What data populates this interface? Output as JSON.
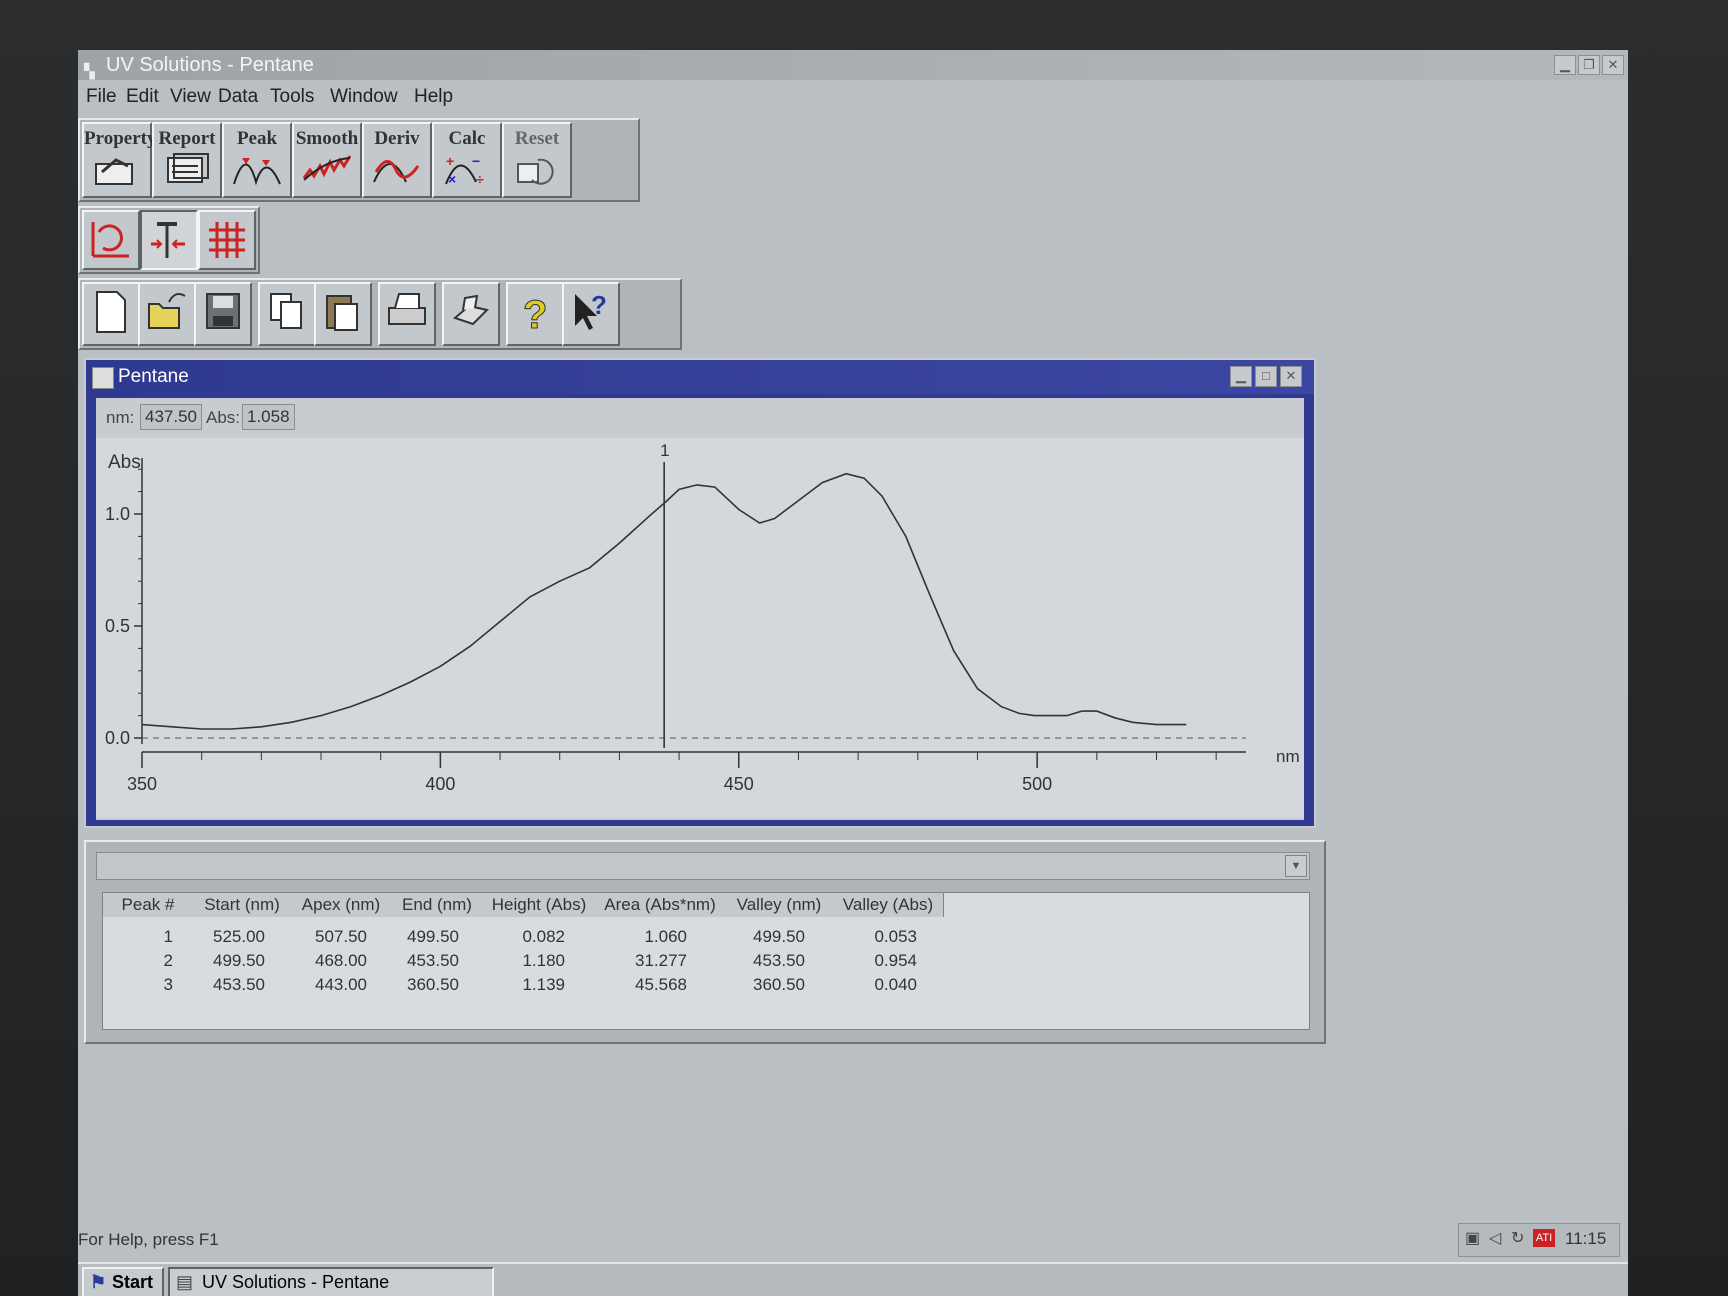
{
  "app": {
    "title": "UV Solutions - Pentane"
  },
  "menu": [
    "File",
    "Edit",
    "View",
    "Data",
    "Tools",
    "Window",
    "Help"
  ],
  "toolbar_main": [
    "Property",
    "Report",
    "Peak",
    "Smooth",
    "Deriv",
    "Calc",
    "Reset"
  ],
  "child": {
    "title": "Pentane",
    "readout": {
      "nm_label": "nm:",
      "nm_value": "437.50",
      "abs_label": "Abs:",
      "abs_value": "1.058"
    }
  },
  "chart_data": {
    "type": "line",
    "ylabel": "Abs",
    "xlabel": "nm",
    "xlim": [
      350,
      535
    ],
    "ylim": [
      0,
      1.25
    ],
    "x_ticks": [
      "350",
      "400",
      "450",
      "500"
    ],
    "y_ticks": [
      "0.0",
      "0.5",
      "1.0"
    ],
    "cursor": {
      "x": 437.5,
      "label": "1"
    },
    "series": [
      {
        "x": [
          350,
          355,
          360,
          365,
          370,
          375,
          380,
          385,
          390,
          395,
          400,
          405,
          410,
          415,
          420,
          425,
          430,
          435,
          438,
          440,
          443,
          446,
          450,
          453.5,
          456,
          460,
          464,
          468,
          471,
          474,
          478,
          482,
          486,
          490,
          494,
          497,
          499.5,
          502,
          505,
          507.5,
          510,
          513,
          516,
          520,
          525
        ],
        "y": [
          0.06,
          0.05,
          0.04,
          0.04,
          0.05,
          0.07,
          0.1,
          0.14,
          0.19,
          0.25,
          0.32,
          0.41,
          0.52,
          0.63,
          0.7,
          0.76,
          0.87,
          0.99,
          1.06,
          1.11,
          1.13,
          1.12,
          1.02,
          0.96,
          0.98,
          1.06,
          1.14,
          1.18,
          1.16,
          1.08,
          0.9,
          0.64,
          0.39,
          0.22,
          0.14,
          0.11,
          0.1,
          0.1,
          0.1,
          0.12,
          0.12,
          0.09,
          0.07,
          0.06,
          0.06
        ]
      }
    ],
    "baseline": {
      "y": 0.0,
      "style": "dashed"
    }
  },
  "peaks": {
    "columns": [
      "Peak #",
      "Start (nm)",
      "Apex (nm)",
      "End (nm)",
      "Height (Abs)",
      "Area (Abs*nm)",
      "Valley (nm)",
      "Valley (Abs)"
    ],
    "rows": [
      [
        "1",
        "525.00",
        "507.50",
        "499.50",
        "0.082",
        "1.060",
        "499.50",
        "0.053"
      ],
      [
        "2",
        "499.50",
        "468.00",
        "453.50",
        "1.180",
        "31.277",
        "453.50",
        "0.954"
      ],
      [
        "3",
        "453.50",
        "443.00",
        "360.50",
        "1.139",
        "45.568",
        "360.50",
        "0.040"
      ]
    ]
  },
  "status": {
    "help": "For Help, press F1",
    "time": "11:15"
  },
  "taskbar": {
    "start": "Start",
    "task": "UV Solutions - Pentane"
  }
}
